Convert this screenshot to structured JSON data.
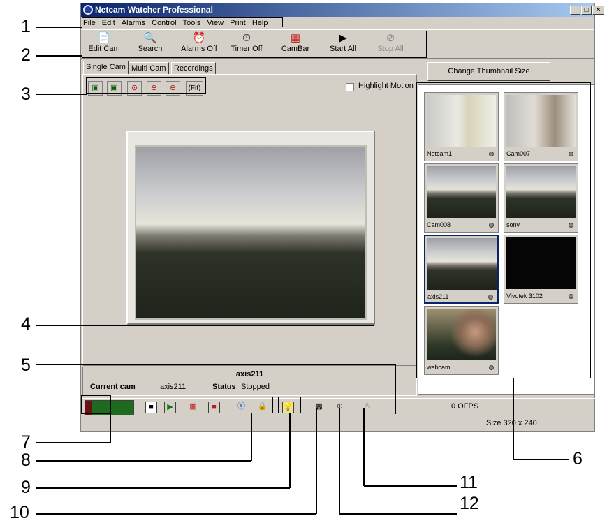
{
  "window": {
    "title": "Netcam Watcher Professional",
    "min": "_",
    "max": "□",
    "close": "×"
  },
  "menu": [
    "File",
    "Edit",
    "Alarms",
    "Control",
    "Tools",
    "View",
    "Print",
    "Help"
  ],
  "toolbar": [
    {
      "label": "Edit Cam",
      "icon": "📄"
    },
    {
      "label": "Search",
      "icon": "🔍"
    },
    {
      "label": "Alarms Off",
      "icon": "⏰"
    },
    {
      "label": "Timer Off",
      "icon": "⏱"
    },
    {
      "label": "CamBar",
      "icon": "▦"
    },
    {
      "label": "Start All",
      "icon": "▶"
    },
    {
      "label": "Stop All",
      "icon": "⊘"
    }
  ],
  "tabs": [
    "Single Cam",
    "Multi Cam",
    "Recordings"
  ],
  "cam_toolbar": {
    "fit": "(Fit)"
  },
  "highlight_motion": "Highlight Motion",
  "thumb_button": "Change Thumbnail Size",
  "thumbnails": [
    "Netcam1",
    "Cam007",
    "Cam008",
    "sony",
    "axis211",
    "Vivotek 3102",
    "webcam"
  ],
  "info": {
    "cam_name": "axis211",
    "current_cam_label": "Current cam",
    "current_cam_value": "axis211",
    "status_label": "Status",
    "status_value": "Stopped"
  },
  "fps": "0 OFPS",
  "size": "Size 320 x 240",
  "callouts": [
    "1",
    "2",
    "3",
    "4",
    "5",
    "6",
    "7",
    "8",
    "9",
    "10",
    "11",
    "12"
  ]
}
